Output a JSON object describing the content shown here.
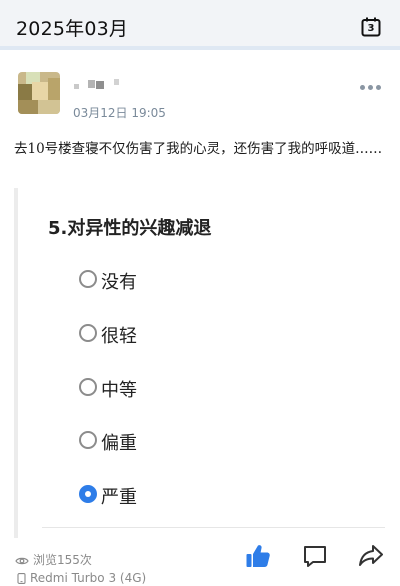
{
  "header": {
    "title": "2025年03月",
    "calendar_day": "3"
  },
  "post": {
    "time": "03月12日 19:05",
    "text": "去10号楼查寝不仅伤害了我的心灵，还伤害了我的呼吸道……"
  },
  "survey": {
    "question": "5.对异性的兴趣减退",
    "options": [
      {
        "label": "没有",
        "selected": false
      },
      {
        "label": "很轻",
        "selected": false
      },
      {
        "label": "中等",
        "selected": false
      },
      {
        "label": "偏重",
        "selected": false
      },
      {
        "label": "严重",
        "selected": true
      }
    ]
  },
  "footer": {
    "views": "浏览155次",
    "device": "Redmi Turbo 3 (4G)"
  },
  "colors": {
    "accent": "#2e7de8",
    "header_bg": "#f2f4f7",
    "secondary_text": "#8a8a8a"
  },
  "icons": [
    "calendar-icon",
    "more-icon",
    "eye-icon",
    "phone-icon",
    "like-icon",
    "comment-icon",
    "share-icon"
  ]
}
